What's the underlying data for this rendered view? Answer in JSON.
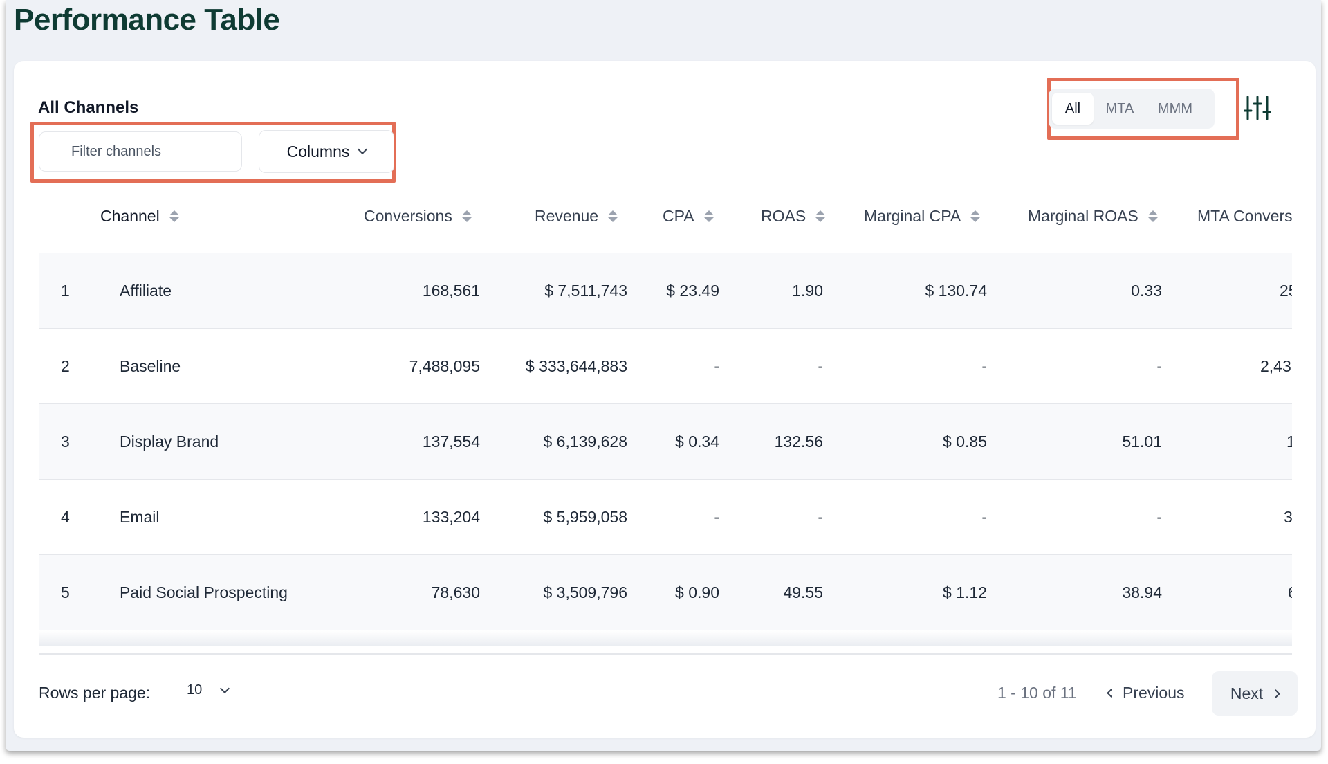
{
  "page_title": "Performance Table",
  "section_title": "All Channels",
  "filter": {
    "placeholder": "Filter channels"
  },
  "columns_button": "Columns",
  "segments": [
    "All",
    "MTA",
    "MMM"
  ],
  "active_segment": "All",
  "table": {
    "headers": [
      "Channel",
      "Conversions",
      "Revenue",
      "CPA",
      "ROAS",
      "Marginal CPA",
      "Marginal ROAS",
      "MTA Convers"
    ],
    "rows": [
      {
        "index": "1",
        "channel": "Affiliate",
        "conversions": "168,561",
        "revenue": "$ 7,511,743",
        "cpa": "$ 23.49",
        "roas": "1.90",
        "marginal_cpa": "$ 130.74",
        "marginal_roas": "0.33",
        "mta": "25"
      },
      {
        "index": "2",
        "channel": "Baseline",
        "conversions": "7,488,095",
        "revenue": "$ 333,644,883",
        "cpa": "-",
        "roas": "-",
        "marginal_cpa": "-",
        "marginal_roas": "-",
        "mta": "2,43"
      },
      {
        "index": "3",
        "channel": "Display Brand",
        "conversions": "137,554",
        "revenue": "$ 6,139,628",
        "cpa": "$ 0.34",
        "roas": "132.56",
        "marginal_cpa": "$ 0.85",
        "marginal_roas": "51.01",
        "mta": "1"
      },
      {
        "index": "4",
        "channel": "Email",
        "conversions": "133,204",
        "revenue": "$ 5,959,058",
        "cpa": "-",
        "roas": "-",
        "marginal_cpa": "-",
        "marginal_roas": "-",
        "mta": "3"
      },
      {
        "index": "5",
        "channel": "Paid Social Prospecting",
        "conversions": "78,630",
        "revenue": "$ 3,509,796",
        "cpa": "$ 0.90",
        "roas": "49.55",
        "marginal_cpa": "$ 1.12",
        "marginal_roas": "38.94",
        "mta": "6"
      }
    ]
  },
  "footer": {
    "rows_per_page_label": "Rows per page:",
    "rows_per_page_value": "10",
    "range": "1 - 10 of 11",
    "previous": "Previous",
    "next": "Next"
  },
  "colors": {
    "highlight": "#e36e56",
    "title": "#0e3b33"
  },
  "icons": [
    "chevron-down-icon",
    "sliders-icon",
    "sort-icon",
    "chevron-left-icon",
    "chevron-right-icon"
  ]
}
